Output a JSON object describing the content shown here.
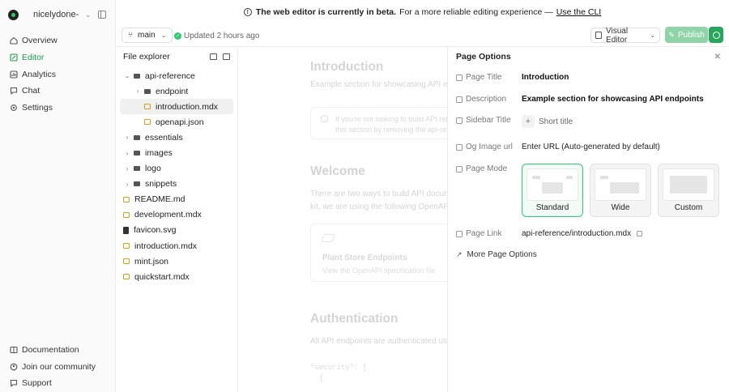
{
  "org": {
    "name": "nicelydone-..."
  },
  "nav": {
    "items": [
      {
        "label": "Overview",
        "icon": "home-icon"
      },
      {
        "label": "Editor",
        "icon": "editor-icon",
        "active": true
      },
      {
        "label": "Analytics",
        "icon": "analytics-icon"
      },
      {
        "label": "Chat",
        "icon": "chat-icon"
      },
      {
        "label": "Settings",
        "icon": "gear-icon"
      }
    ],
    "bottom": [
      {
        "label": "Documentation",
        "icon": "book-icon"
      },
      {
        "label": "Join our community",
        "icon": "community-icon"
      },
      {
        "label": "Support",
        "icon": "support-icon"
      }
    ]
  },
  "banner": {
    "bold": "The web editor is currently in beta.",
    "text": "For a more reliable editing experience —",
    "link": "Use the CLI"
  },
  "toolbar": {
    "branch": "main",
    "updated": "Updated 2 hours ago",
    "visual_editor": "Visual Editor",
    "publish": "Publish"
  },
  "explorer": {
    "title": "File explorer",
    "tree": [
      {
        "label": "api-reference",
        "type": "folder",
        "indent": 0,
        "arrow": "down"
      },
      {
        "label": "endpoint",
        "type": "folder",
        "indent": 1,
        "arrow": "right"
      },
      {
        "label": "introduction.mdx",
        "type": "file",
        "indent": 1,
        "selected": true
      },
      {
        "label": "openapi.json",
        "type": "file",
        "indent": 1
      },
      {
        "label": "essentials",
        "type": "folder",
        "indent": 0,
        "arrow": "right"
      },
      {
        "label": "images",
        "type": "folder",
        "indent": 0,
        "arrow": "right"
      },
      {
        "label": "logo",
        "type": "folder",
        "indent": 0,
        "arrow": "right"
      },
      {
        "label": "snippets",
        "type": "folder",
        "indent": 0,
        "arrow": "right"
      },
      {
        "label": "README.md",
        "type": "file",
        "indent": -1
      },
      {
        "label": "development.mdx",
        "type": "file",
        "indent": -1
      },
      {
        "label": "favicon.svg",
        "type": "svg",
        "indent": -1
      },
      {
        "label": "introduction.mdx",
        "type": "file",
        "indent": -1
      },
      {
        "label": "mint.json",
        "type": "file",
        "indent": -1
      },
      {
        "label": "quickstart.mdx",
        "type": "file",
        "indent": -1
      }
    ]
  },
  "canvas": {
    "h1": "Introduction",
    "p1": "Example section for showcasing API en",
    "note1": "If you're not looking to build API refe",
    "note2": "this section by removing the api-refe",
    "h2": "Welcome",
    "p2a": "There are two ways to build API docum",
    "p2b": "kit, we are using the following OpenAPI",
    "card_title": "Plant Store Endpoints",
    "card_sub": "View the OpenAPI specification file",
    "h3": "Authentication",
    "p3": "All API endpoints are authenticated usi",
    "code1": "\"security\": [",
    "code2": "  {"
  },
  "panel": {
    "title": "Page Options",
    "fields": {
      "page_title_label": "Page Title",
      "page_title_value": "Introduction",
      "description_label": "Description",
      "description_value": "Example section for showcasing API endpoints",
      "sidebar_title_label": "Sidebar Title",
      "sidebar_title_value": "Short title",
      "og_label": "Og Image url",
      "og_placeholder": "Enter URL (Auto-generated by default)",
      "mode_label": "Page Mode",
      "link_label": "Page Link",
      "link_value": "api-reference/introduction.mdx"
    },
    "modes": [
      {
        "label": "Standard",
        "active": true
      },
      {
        "label": "Wide"
      },
      {
        "label": "Custom"
      }
    ],
    "more": "More Page Options"
  },
  "colors": {
    "accent": "#26a85c",
    "publish_bg": "#8fd4a6",
    "active_nav": "#1d9b4e"
  }
}
